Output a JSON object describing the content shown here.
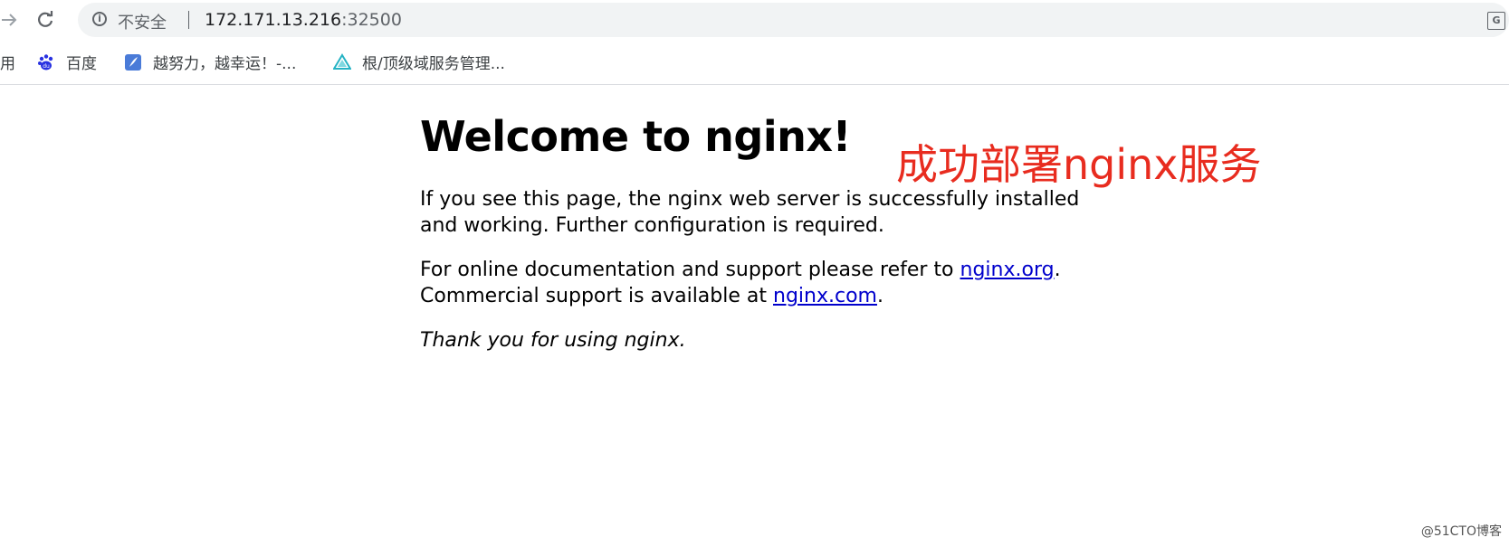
{
  "browser": {
    "security_label": "不安全",
    "url_host": "172.171.13.216",
    "url_port": ":32500",
    "icons": {
      "forward": "forward-arrow-icon",
      "reload": "reload-icon",
      "info": "info-icon",
      "translate": "translate-icon"
    }
  },
  "bookmarks": {
    "apps_partial": "用",
    "items": [
      {
        "label": "百度",
        "icon": "baidu-paw-icon"
      },
      {
        "label": "越努力，越幸运！-...",
        "icon": "feather-icon"
      },
      {
        "label": "根/顶级域服务管理...",
        "icon": "triangle-logo-icon"
      }
    ]
  },
  "page": {
    "title": "Welcome to nginx!",
    "annotation": "成功部署nginx服务",
    "annotation_color": "#e82c1f",
    "para1": "If you see this page, the nginx web server is successfully installed and working. Further configuration is required.",
    "para2_prefix": "For online documentation and support please refer to ",
    "link_org": "nginx.org",
    "para2_mid": ".",
    "para2_line2": "Commercial support is available at ",
    "link_com": "nginx.com",
    "para2_end": ".",
    "thanks": "Thank you for using nginx."
  },
  "watermark": "@51CTO博客"
}
